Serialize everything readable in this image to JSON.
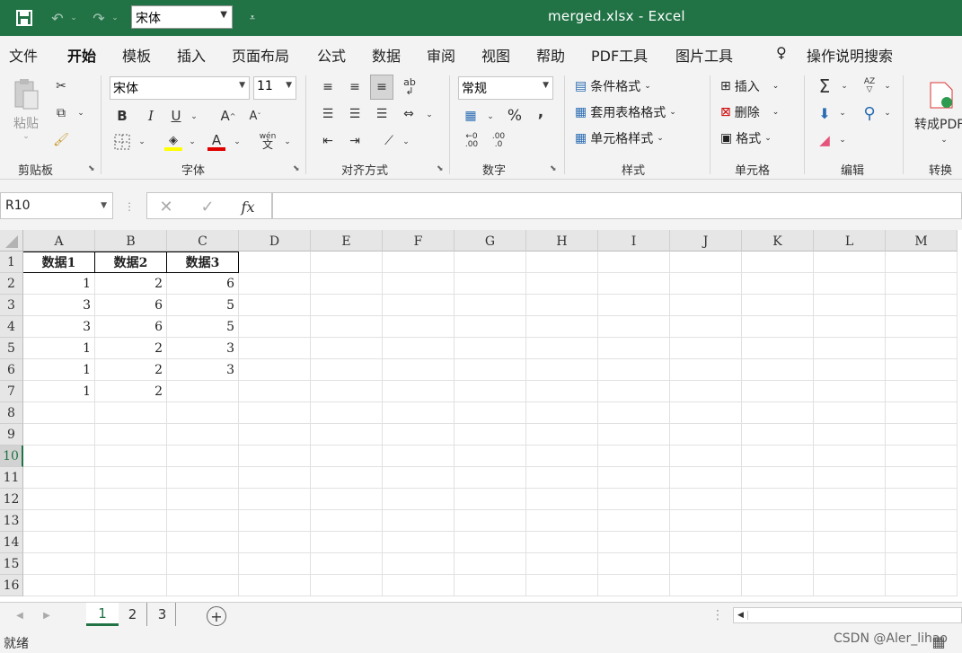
{
  "titlebar": {
    "doc_title": "merged.xlsx  -  Excel",
    "quick_font": "宋体",
    "accent": "#217346"
  },
  "menu": [
    "文件",
    "开始",
    "模板",
    "插入",
    "页面布局",
    "公式",
    "数据",
    "审阅",
    "视图",
    "帮助",
    "PDF工具",
    "图片工具",
    "操作说明搜索"
  ],
  "ribbon": {
    "clipboard": {
      "paste": "粘贴",
      "label": "剪贴板"
    },
    "font": {
      "name": "宋体",
      "size": "11",
      "label": "字体",
      "bold": "B",
      "italic": "I",
      "underline": "U",
      "grow": "A",
      "shrink": "A",
      "color_a": "A",
      "phonetic": "wén"
    },
    "align": {
      "label": "对齐方式",
      "wrap": "ab"
    },
    "number": {
      "format": "常规",
      "label": "数字",
      "percent": "%",
      "comma": ",",
      "inc": ".00",
      "dec": ".0"
    },
    "styles": {
      "cond": "条件格式",
      "table": "套用表格格式",
      "cell": "单元格样式",
      "label": "样式"
    },
    "cells": {
      "insert": "插入",
      "delete": "删除",
      "format": "格式",
      "label": "单元格"
    },
    "edit": {
      "label": "编辑",
      "sigma": "Σ",
      "sort": "AZ"
    },
    "convert": {
      "btn": "转成PDF",
      "label": "转换"
    }
  },
  "formula": {
    "namebox": "R10",
    "fx": "fx",
    "value": ""
  },
  "grid": {
    "columns": [
      "A",
      "B",
      "C",
      "D",
      "E",
      "F",
      "G",
      "H",
      "I",
      "J",
      "K",
      "L",
      "M"
    ],
    "rows": [
      "1",
      "2",
      "3",
      "4",
      "5",
      "6",
      "7",
      "8",
      "9",
      "10",
      "11",
      "12",
      "13",
      "14",
      "15",
      "16"
    ],
    "selected_row": "10",
    "data": [
      [
        "数据1",
        "数据2",
        "数据3"
      ],
      [
        "1",
        "2",
        "6"
      ],
      [
        "3",
        "6",
        "5"
      ],
      [
        "3",
        "6",
        "5"
      ],
      [
        "1",
        "2",
        "3"
      ],
      [
        "1",
        "2",
        "3"
      ],
      [
        "1",
        "2",
        ""
      ]
    ]
  },
  "sheets": [
    "1",
    "2",
    "3"
  ],
  "active_sheet": "1",
  "status": {
    "ready": "就绪",
    "watermark": "CSDN @Aler_lihao"
  }
}
